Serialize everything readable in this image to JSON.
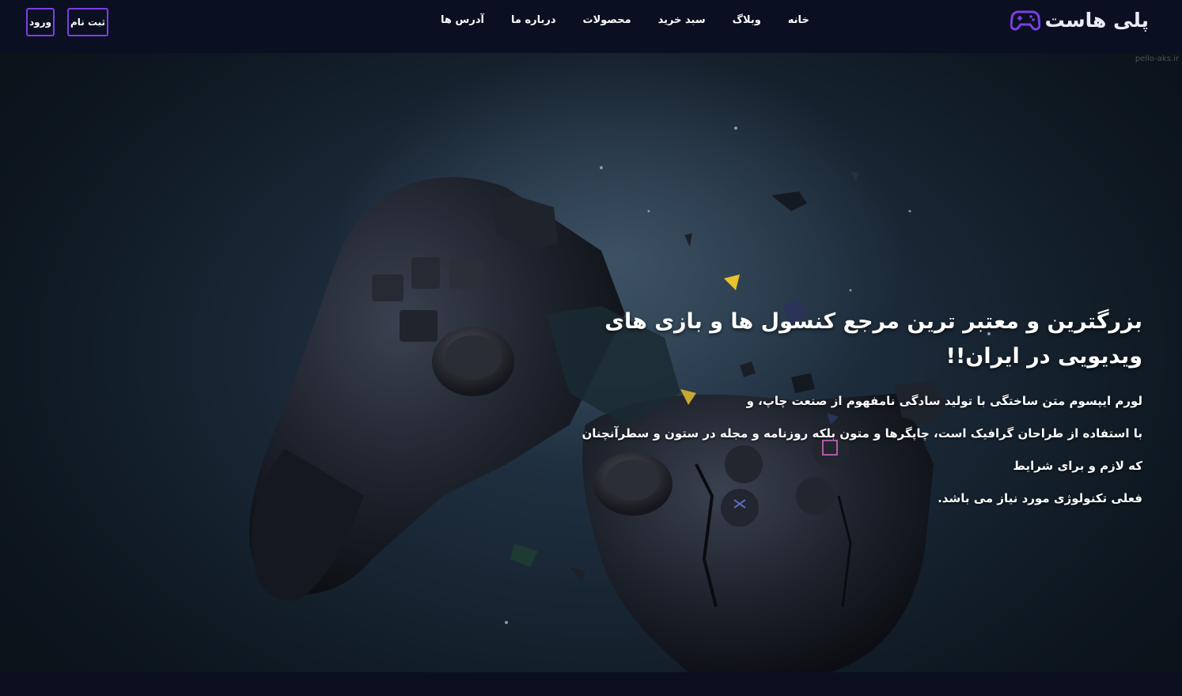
{
  "brand": {
    "name": "پلی هاست",
    "icon": "gamepad-icon",
    "accent_color": "#7b3fe4"
  },
  "nav": {
    "items": [
      {
        "label": "خانه"
      },
      {
        "label": "وبلاگ"
      },
      {
        "label": "سبد خرید"
      },
      {
        "label": "محصولات"
      },
      {
        "label": "درباره ما"
      },
      {
        "label": "آدرس ها"
      }
    ]
  },
  "auth": {
    "register_label": "ثبت نام",
    "login_label": "ورود"
  },
  "hero": {
    "title": "بزرگترین و معتبر ترین مرجع کنسول ها و بازی های ویدیویی در ایران!!",
    "lines": [
      "لورم ایپسوم متن ساختگی با تولید سادگی نامفهوم از صنعت چاپ، و",
      "با استفاده از طراحان گرافیک است، چاپگرها و متون بلکه روزنامه و مجله در ستون و سطرآنچنان که لازم و برای شرایط",
      "فعلی تکنولوژی مورد نیاز می باشد."
    ],
    "image": "exploding-game-controller-image"
  },
  "watermark": "pello-aks.ir",
  "colors": {
    "navbar_bg": "#0b0f22",
    "hero_bg": "#1a2837"
  }
}
